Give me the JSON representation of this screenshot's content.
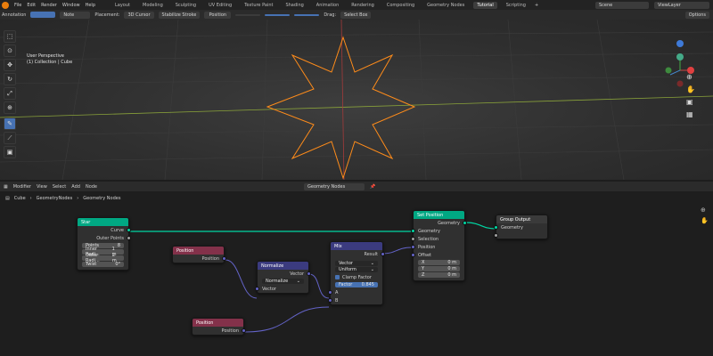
{
  "menu": {
    "items": [
      "File",
      "Edit",
      "Render",
      "Window",
      "Help"
    ]
  },
  "workspaces": [
    "Layout",
    "Modeling",
    "Sculpting",
    "UV Editing",
    "Texture Paint",
    "Shading",
    "Animation",
    "Rendering",
    "Compositing",
    "Geometry Nodes",
    "Tutorial",
    "Scripting"
  ],
  "active_workspace": "Tutorial",
  "scene": "Scene",
  "view_layer": "ViewLayer",
  "vp_header": {
    "mode": "Object Mode",
    "menus": [
      "View",
      "Select",
      "Add",
      "Object"
    ],
    "orientation": "Global",
    "annotation": "Annotation",
    "note": "Note",
    "placement": "Placement:",
    "cursor": "3D Cursor",
    "stabilize": "Stabilize Stroke",
    "position": "Position",
    "drag": "Drag:",
    "select_box": "Select Box",
    "options": "Options"
  },
  "viewport": {
    "perspective": "User Perspective",
    "collection": "(1) Collection | Cube"
  },
  "node_header": {
    "editor": "Modifier",
    "menus": [
      "View",
      "Select",
      "Add",
      "Node"
    ],
    "tree": "Geometry Nodes"
  },
  "breadcrumb": [
    "Cube",
    "GeometryNodes",
    "Geometry Nodes"
  ],
  "nodes": {
    "star": {
      "title": "Star",
      "out_curve": "Curve",
      "out_outer": "Outer Points",
      "fields": [
        {
          "label": "Points",
          "value": "8"
        },
        {
          "label": "Inner Radi...",
          "value": "1 m"
        },
        {
          "label": "Outer Radi...",
          "value": "2 m"
        },
        {
          "label": "Twist",
          "value": "0°"
        }
      ]
    },
    "pos1": {
      "title": "Position",
      "out": "Position"
    },
    "normalize": {
      "title": "Normalize",
      "out": "Vector",
      "mode": "Normalize",
      "in": "Vector"
    },
    "pos2": {
      "title": "Position",
      "out": "Position"
    },
    "mix": {
      "title": "Mix",
      "out": "Result",
      "dtype": "Vector",
      "mode": "Uniform",
      "clamp": "Clamp Factor",
      "factor_label": "Factor",
      "factor_value": "0.845",
      "a": "A",
      "b": "B"
    },
    "setpos": {
      "title": "Set Position",
      "out": "Geometry",
      "geometry": "Geometry",
      "selection": "Selection",
      "position": "Position",
      "offset": "Offset",
      "offs": [
        {
          "axis": "X",
          "value": "0 m"
        },
        {
          "axis": "Y",
          "value": "0 m"
        },
        {
          "axis": "Z",
          "value": "0 m"
        }
      ]
    },
    "group_out": {
      "title": "Group Output",
      "in": "Geometry"
    }
  },
  "colors": {
    "geometry": "#00d6a3",
    "vector": "#6363c7",
    "input": "#83314a",
    "utility": "#3b3b7f",
    "accent": "#4772b3",
    "star_outline": "#ff8c1a"
  }
}
